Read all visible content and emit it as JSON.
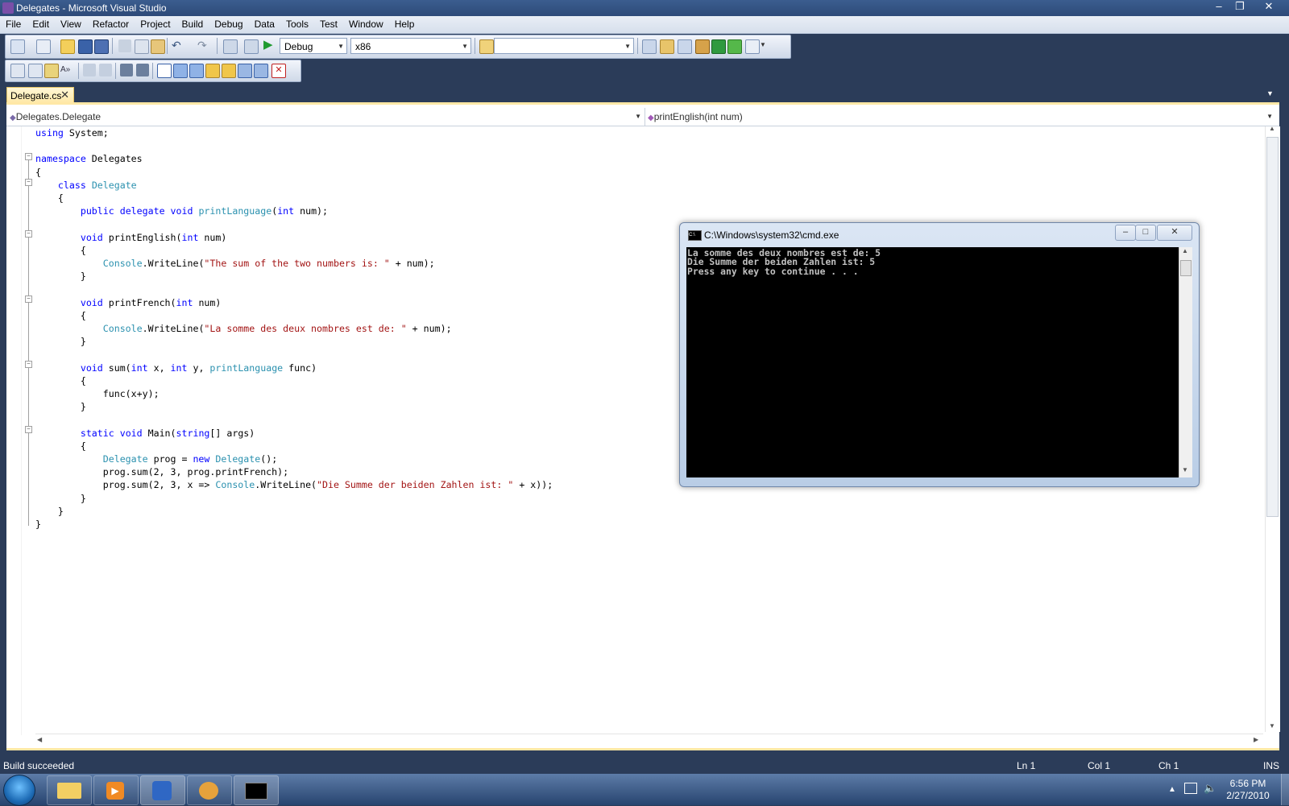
{
  "window": {
    "title": "Delegates - Microsoft Visual Studio"
  },
  "menu": [
    "File",
    "Edit",
    "View",
    "Refactor",
    "Project",
    "Build",
    "Debug",
    "Data",
    "Tools",
    "Test",
    "Window",
    "Help"
  ],
  "toolbar": {
    "config": "Debug",
    "platform": "x86",
    "find_value": ""
  },
  "tab": {
    "label": "Delegate.cs"
  },
  "nav": {
    "left": "Delegates.Delegate",
    "right": "printEnglish(int num)"
  },
  "code_lines": [
    "using System;",
    "",
    "namespace Delegates",
    "{",
    "    class Delegate",
    "    {",
    "        public delegate void printLanguage(int num);",
    "",
    "        void printEnglish(int num)",
    "        {",
    "            Console.WriteLine(\"The sum of the two numbers is: \" + num);",
    "        }",
    "",
    "        void printFrench(int num)",
    "        {",
    "            Console.WriteLine(\"La somme des deux nombres est de: \" + num);",
    "        }",
    "",
    "        void sum(int x, int y, printLanguage func)",
    "        {",
    "            func(x+y);",
    "        }",
    "",
    "        static void Main(string[] args)",
    "        {",
    "            Delegate prog = new Delegate();",
    "            prog.sum(2, 3, prog.printFrench);",
    "            prog.sum(2, 3, x => Console.WriteLine(\"Die Summe der beiden Zahlen ist: \" + x));",
    "        }",
    "    }",
    "}"
  ],
  "console": {
    "title": "C:\\Windows\\system32\\cmd.exe",
    "lines": [
      "La somme des deux nombres est de: 5",
      "Die Summe der beiden Zahlen ist: 5",
      "Press any key to continue . . ."
    ]
  },
  "status": {
    "message": "Build succeeded",
    "ln": "Ln 1",
    "col": "Col 1",
    "ch": "Ch 1",
    "mode": "INS"
  },
  "clock": {
    "time": "6:56 PM",
    "date": "2/27/2010"
  }
}
